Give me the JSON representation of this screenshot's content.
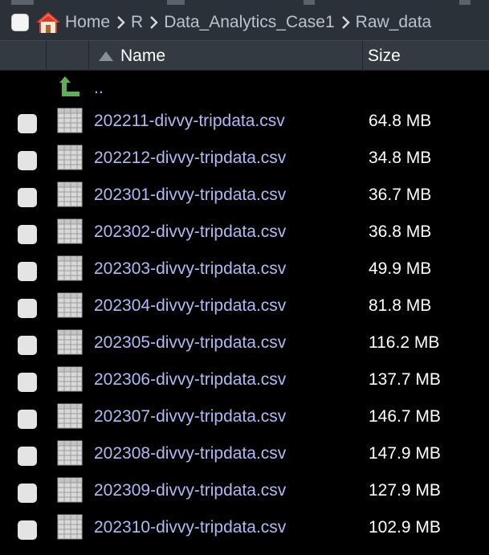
{
  "breadcrumb": {
    "items": [
      "Home",
      "R",
      "Data_Analytics_Case1",
      "Raw_data"
    ]
  },
  "header": {
    "name_label": "Name",
    "size_label": "Size"
  },
  "parent_row": {
    "label": ".."
  },
  "files": [
    {
      "name": "202211-divvy-tripdata.csv",
      "size": "64.8 MB"
    },
    {
      "name": "202212-divvy-tripdata.csv",
      "size": "34.8 MB"
    },
    {
      "name": "202301-divvy-tripdata.csv",
      "size": "36.7 MB"
    },
    {
      "name": "202302-divvy-tripdata.csv",
      "size": "36.8 MB"
    },
    {
      "name": "202303-divvy-tripdata.csv",
      "size": "49.9 MB"
    },
    {
      "name": "202304-divvy-tripdata.csv",
      "size": "81.8 MB"
    },
    {
      "name": "202305-divvy-tripdata.csv",
      "size": "116.2 MB"
    },
    {
      "name": "202306-divvy-tripdata.csv",
      "size": "137.7 MB"
    },
    {
      "name": "202307-divvy-tripdata.csv",
      "size": "146.7 MB"
    },
    {
      "name": "202308-divvy-tripdata.csv",
      "size": "147.9 MB"
    },
    {
      "name": "202309-divvy-tripdata.csv",
      "size": "127.9 MB"
    },
    {
      "name": "202310-divvy-tripdata.csv",
      "size": "102.9 MB"
    }
  ],
  "colors": {
    "background": "#000000",
    "toolbar": "#2b3139",
    "header": "#343a42",
    "link_text": "#b3b8f5",
    "breadcrumb_text": "#b9c3cf",
    "up_arrow": "#5fae58",
    "home_roof": "#d83c2a"
  },
  "icons": {
    "home": "home-icon",
    "separator": "chevron-right-icon",
    "sort": "sort-ascending-icon",
    "parent": "up-arrow-icon",
    "file": "spreadsheet-file-icon"
  }
}
